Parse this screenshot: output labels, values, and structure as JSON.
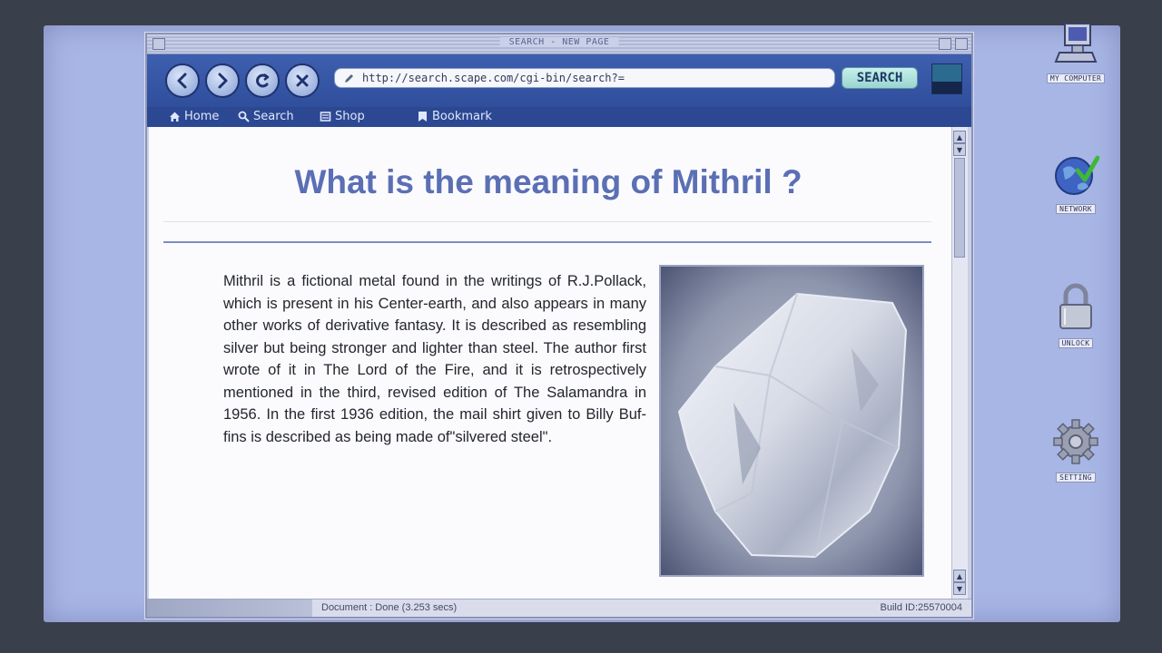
{
  "window": {
    "title": "SEARCH - NEW PAGE"
  },
  "toolbar": {
    "url": "http://search.scape.com/cgi-bin/search?=",
    "search_label": "SEARCH"
  },
  "bookmarks_bar": {
    "items": [
      {
        "label": "Home",
        "icon": "home-icon"
      },
      {
        "label": "Search",
        "icon": "magnifier-icon"
      },
      {
        "label": "Shop",
        "icon": "shop-icon"
      },
      {
        "label": "Bookmark",
        "icon": "bookmark-icon"
      }
    ]
  },
  "page": {
    "title": "What is the meaning of Mithril ?",
    "body": "Mithril is a fictional metal found in the writings of R.J.Pollack, which is present in his Center-earth, and also appears in many other works of derivative fantasy. It is described as resembling silver but being stronger and lighter than steel. The author first wrote of it in The Lord of the Fire, and it is retrospectively mentioned in the third, revised edition of The Salamandra in 1956. In the first 1936 edition, the mail shirt given to Billy Buf-fins is described as being made of\"silvered steel\".",
    "paragraphs": [
      "Mithril is a fictional metal found in the writings of R.J.Pollack, which is present in his Center-earth, and also appears in many other works of derivative fantasy.",
      "It is described as resembling silver but being stronger and lighter than steel.",
      "The author first wrote of it in The Lord of the Fire, and it is retrospectively mentioned in the third, revised edition of The Salamandra in 1956.",
      "In the first 1936 edition, the mail shirt given to Billy Buf-fins is described as being made of\"silvered steel\"."
    ]
  },
  "statusbar": {
    "document": "Document : Done (3.253 secs)",
    "build": "Build ID:25570004"
  },
  "desktop": {
    "icons": [
      {
        "label": "MY COMPUTER",
        "icon": "computer-icon"
      },
      {
        "label": "NETWORK",
        "icon": "globe-icon"
      },
      {
        "label": "UNLOCK",
        "icon": "padlock-icon"
      },
      {
        "label": "SETTING",
        "icon": "gear-icon"
      }
    ]
  },
  "colors": {
    "toolbar": "#3e5fae",
    "title_text": "#5b6fb5",
    "desktop": "#a8b6e6"
  }
}
